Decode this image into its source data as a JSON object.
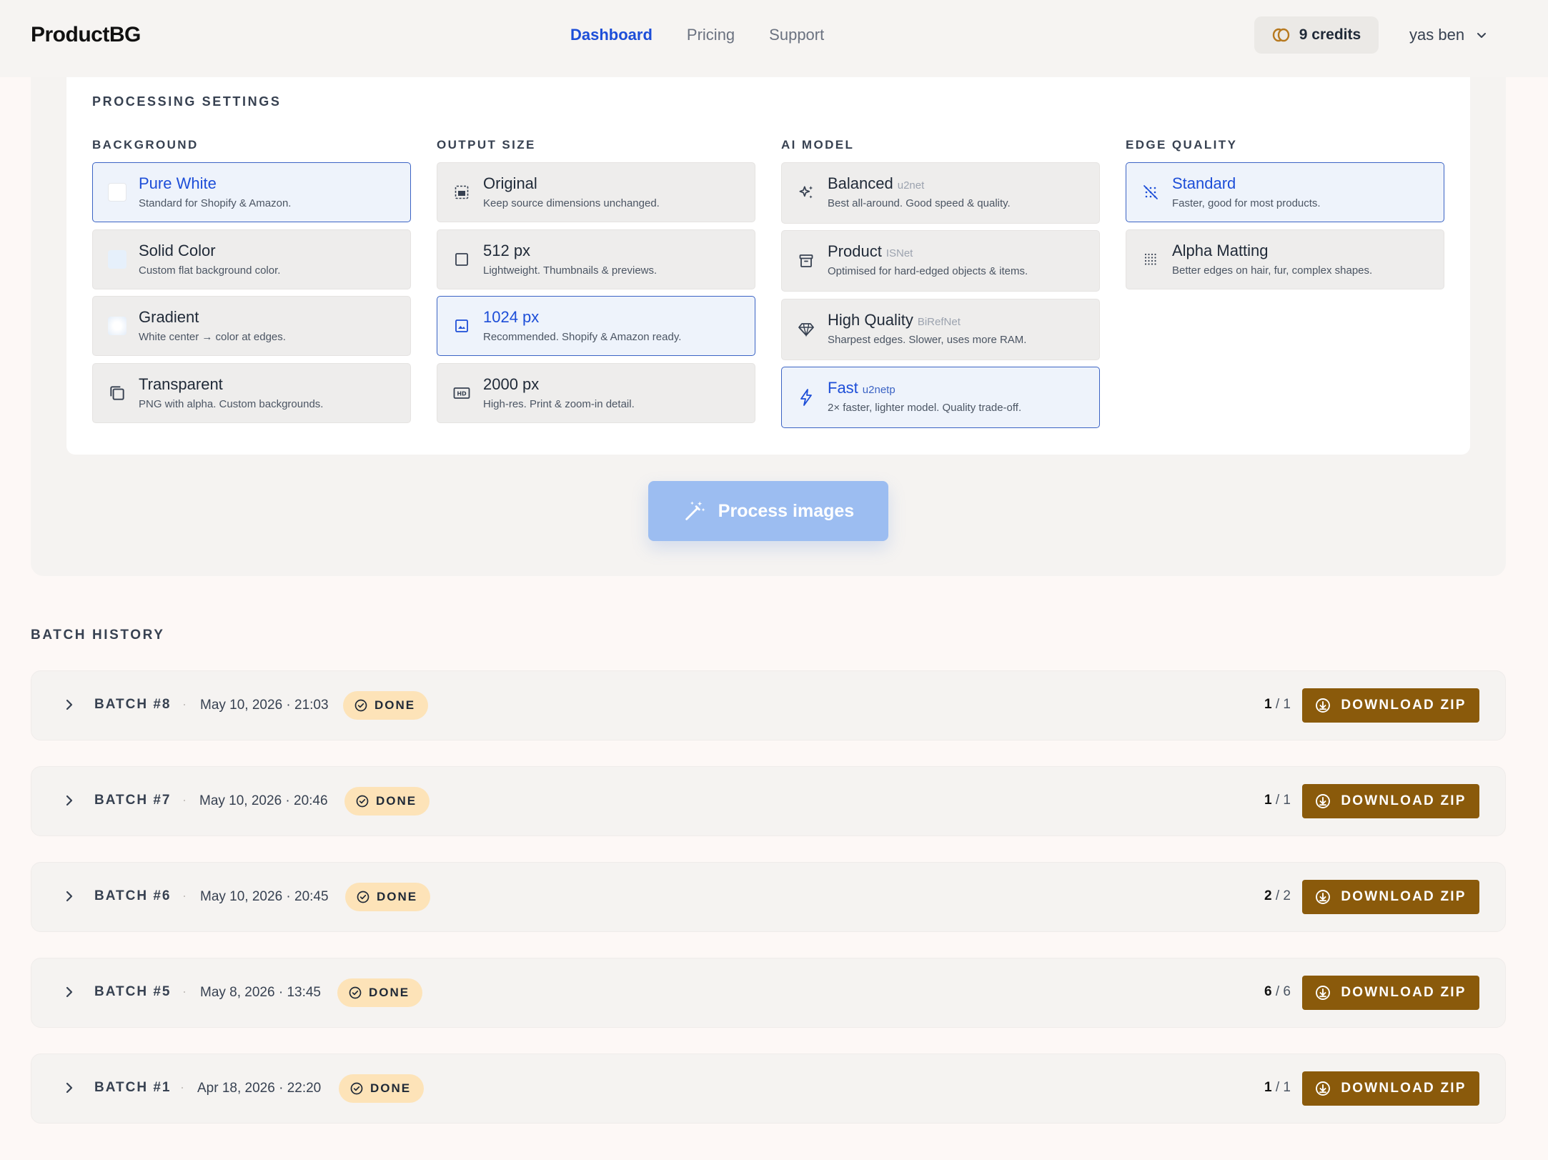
{
  "header": {
    "brand": "ProductBG",
    "nav": [
      {
        "label": "Dashboard",
        "active": true
      },
      {
        "label": "Pricing",
        "active": false
      },
      {
        "label": "Support",
        "active": false
      }
    ],
    "credits": "9 credits",
    "user": "yas ben"
  },
  "settings": {
    "title": "PROCESSING SETTINGS",
    "background": {
      "title": "BACKGROUND",
      "options": [
        {
          "name": "Pure White",
          "desc": "Standard for Shopify & Amazon.",
          "selected": true,
          "icon": "white-swatch"
        },
        {
          "name": "Solid Color",
          "desc": "Custom flat background color.",
          "selected": false,
          "icon": "solid-swatch"
        },
        {
          "name": "Gradient",
          "desc": "White center → color at edges.",
          "selected": false,
          "icon": "gradient-swatch"
        },
        {
          "name": "Transparent",
          "desc": "PNG with alpha. Custom backgrounds.",
          "selected": false,
          "icon": "copy-icon"
        }
      ]
    },
    "output_size": {
      "title": "OUTPUT SIZE",
      "options": [
        {
          "name": "Original",
          "desc": "Keep source dimensions unchanged.",
          "selected": false,
          "icon": "image-frame-icon"
        },
        {
          "name": "512 px",
          "desc": "Lightweight. Thumbnails & previews.",
          "selected": false,
          "icon": "square-icon"
        },
        {
          "name": "1024 px",
          "desc": "Recommended. Shopify & Amazon ready.",
          "selected": true,
          "icon": "image-icon"
        },
        {
          "name": "2000 px",
          "desc": "High-res. Print & zoom-in detail.",
          "selected": false,
          "icon": "hd-icon"
        }
      ]
    },
    "ai_model": {
      "title": "AI MODEL",
      "options": [
        {
          "name": "Balanced",
          "tag": "u2net",
          "desc": "Best all-around. Good speed & quality.",
          "selected": false,
          "icon": "sparkles-icon"
        },
        {
          "name": "Product",
          "tag": "ISNet",
          "desc": "Optimised for hard-edged objects & items.",
          "selected": false,
          "icon": "archive-box-icon"
        },
        {
          "name": "High Quality",
          "tag": "BiRefNet",
          "desc": "Sharpest edges. Slower, uses more RAM.",
          "selected": false,
          "icon": "diamond-icon"
        },
        {
          "name": "Fast",
          "tag": "u2netp",
          "desc": "2× faster, lighter model. Quality trade-off.",
          "selected": true,
          "icon": "bolt-icon"
        }
      ]
    },
    "edge_quality": {
      "title": "EDGE QUALITY",
      "options": [
        {
          "name": "Standard",
          "desc": "Faster, good for most products.",
          "selected": true,
          "icon": "grid-off-icon"
        },
        {
          "name": "Alpha Matting",
          "desc": "Better edges on hair, fur, complex shapes.",
          "selected": false,
          "icon": "dot-grid-icon"
        }
      ]
    }
  },
  "process_button": "Process images",
  "history": {
    "title": "BATCH HISTORY",
    "status_label": "DONE",
    "download_label": "DOWNLOAD ZIP",
    "batches": [
      {
        "name": "BATCH #8",
        "date": "May 10, 2026 · 21:03",
        "done": "1",
        "total": "/ 1"
      },
      {
        "name": "BATCH #7",
        "date": "May 10, 2026 · 20:46",
        "done": "1",
        "total": "/ 1"
      },
      {
        "name": "BATCH #6",
        "date": "May 10, 2026 · 20:45",
        "done": "2",
        "total": "/ 2"
      },
      {
        "name": "BATCH #5",
        "date": "May 8, 2026 · 13:45",
        "done": "6",
        "total": "/ 6"
      },
      {
        "name": "BATCH #1",
        "date": "Apr 18, 2026 · 22:20",
        "done": "1",
        "total": "/ 1"
      }
    ]
  },
  "colors": {
    "accent": "#1d4ed8",
    "download": "#8a5a0b",
    "badge": "#fde3b8",
    "process_disabled": "#9cbdf1"
  }
}
